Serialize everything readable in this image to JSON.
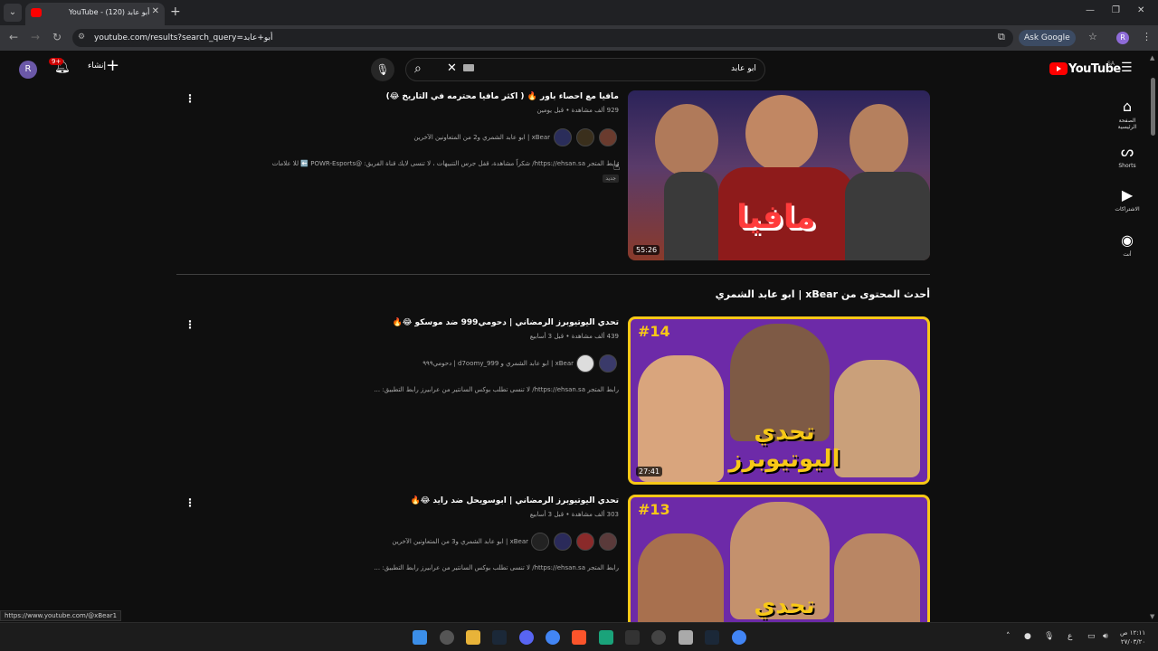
{
  "browser": {
    "tab_title": "YouTube - أبو عابد (120)",
    "url": "youtube.com/results?search_query=أبو+عابد",
    "ask_google": "Ask Google",
    "profile_initial": "R"
  },
  "header": {
    "avatar_initial": "R",
    "notif_badge": "9+",
    "create_label": "إنشاء",
    "search_query": "ابو عابد",
    "logo_text": "YouTube",
    "country": "SA"
  },
  "sidebar": {
    "items": [
      {
        "label": "الصفحة الرئيسية",
        "icon": "home-icon"
      },
      {
        "label": "Shorts",
        "icon": "shorts-icon"
      },
      {
        "label": "الاشتراكات",
        "icon": "subscriptions-icon"
      },
      {
        "label": "أنت",
        "icon": "you-icon"
      }
    ]
  },
  "videos": [
    {
      "title": "مافيا مع احصاء باور 🔥 ( اكثر مافيا محترمه في التاريخ 😂)",
      "meta": "929 ألف مشاهدة • قبل يومين",
      "channel": "xBear | ابو عابد الشمري و2 من المتعاونين الآخرين",
      "desc": "رابط المتجر https://ehsan.sa/ شكراً مشاهدة، قفل جرس التنبيهات ، لا تنسى لايك قناة الفريق: @POWR-Esports ⬅️ للا علامات",
      "badge": "جديد",
      "duration": "55:26",
      "thumb_text": "مافيا"
    },
    {
      "title": "تحدي اليوتيوبرز الرمضاني | دحومي999 ضد موسكو 😂🔥",
      "meta": "439 ألف مشاهدة • قبل 3 أسابيع",
      "channel": "xBear | ابو عابد الشمري و d7oomy_999 | دحومي٩٩٩",
      "desc": "رابط المتجر https://ehsan.sa/ لا تنسى تطلب بوكس السانتير من عرابيرز رابط التطبيق: ...",
      "duration": "27:41",
      "thumb_ep": "#14",
      "thumb_text": "تحدي اليوتيوبرز"
    },
    {
      "title": "تحدي اليوتيوبرز الرمضاني | ابوسويحل ضد رايد 😂🔥",
      "meta": "303 ألف مشاهدة • قبل 3 أسابيع",
      "channel": "xBear | ابو عابد الشمري و3 من المتعاونين الآخرين",
      "desc": "رابط المتجر https://ehsan.sa/ لا تنسى تطلب بوكس السانتير من عرابيرز رابط التطبيق: ...",
      "thumb_ep": "#13",
      "thumb_text": "تحدي"
    }
  ],
  "section_heading": "أحدث المحتوى من xBear | ابو عابد الشمري",
  "status_url": "https://www.youtube.com/@xBear1",
  "taskbar": {
    "time": "١٢:١١ ص",
    "date": "٢٧/٠٣/٢٠"
  },
  "colors": {
    "background": "#0f0f0f",
    "brand_red": "#ff0000",
    "thumb_purple": "#6d2aa8",
    "thumb_yellow": "#f7c817"
  }
}
